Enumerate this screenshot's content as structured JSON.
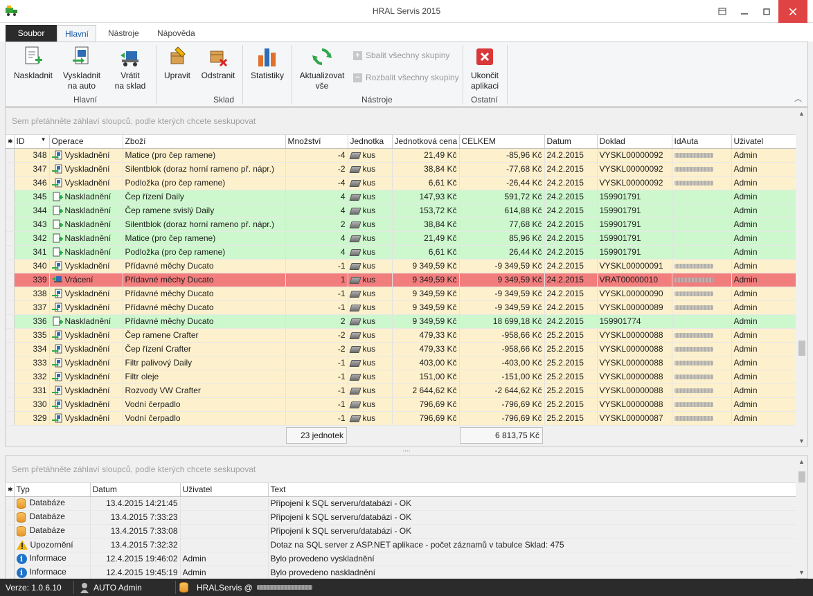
{
  "window": {
    "title": "HRAL Servis 2015"
  },
  "menu": {
    "file": "Soubor",
    "tabs": [
      "Hlavní",
      "Nástroje",
      "Nápověda"
    ]
  },
  "ribbon": {
    "buttons": {
      "naskladnit": "Naskladnit",
      "vyskladnit": "Vyskladnit\nna auto",
      "vratit": "Vrátit\nna sklad",
      "upravit": "Upravit",
      "odstranit": "Odstranit",
      "statistiky": "Statistiky",
      "aktualizovat": "Aktualizovat\nvše",
      "ukoncit": "Ukončit\naplikaci"
    },
    "small": {
      "collapse": "Sbalit všechny skupiny",
      "expand": "Rozbalit všechny skupiny"
    },
    "groups": {
      "hlavni": "Hlavní",
      "sklad": "Sklad",
      "nastroje": "Nástroje",
      "ostatni": "Ostatní"
    }
  },
  "grid": {
    "group_hint": "Sem přetáhněte záhlaví sloupců, podle kterých chcete seskupovat",
    "columns": [
      "ID",
      "Operace",
      "Zboží",
      "Množství",
      "Jednotka",
      "Jednotková cena",
      "CELKEM",
      "Datum",
      "Doklad",
      "IdAuta",
      "Uživatel"
    ],
    "rows": [
      {
        "id": "348",
        "op": "Vyskladnění",
        "type": "vy",
        "item": "Matice (pro čep ramene)",
        "qty": "-4",
        "unit": "kus",
        "price": "21,49 Kč",
        "total": "-85,96 Kč",
        "date": "24.2.2015",
        "doc": "VYSKL00000092",
        "car": true,
        "user": "Admin"
      },
      {
        "id": "347",
        "op": "Vyskladnění",
        "type": "vy",
        "item": "Silentblok (doraz horní rameno př. nápr.)",
        "qty": "-2",
        "unit": "kus",
        "price": "38,84 Kč",
        "total": "-77,68 Kč",
        "date": "24.2.2015",
        "doc": "VYSKL00000092",
        "car": true,
        "user": "Admin"
      },
      {
        "id": "346",
        "op": "Vyskladnění",
        "type": "vy",
        "item": "Podložka (pro čep ramene)",
        "qty": "-4",
        "unit": "kus",
        "price": "6,61 Kč",
        "total": "-26,44 Kč",
        "date": "24.2.2015",
        "doc": "VYSKL00000092",
        "car": true,
        "user": "Admin"
      },
      {
        "id": "345",
        "op": "Naskladnění",
        "type": "na",
        "item": "Čep řízení Daily",
        "qty": "4",
        "unit": "kus",
        "price": "147,93 Kč",
        "total": "591,72 Kč",
        "date": "24.2.2015",
        "doc": "159901791",
        "car": false,
        "user": "Admin"
      },
      {
        "id": "344",
        "op": "Naskladnění",
        "type": "na",
        "item": "Čep ramene svislý Daily",
        "qty": "4",
        "unit": "kus",
        "price": "153,72 Kč",
        "total": "614,88 Kč",
        "date": "24.2.2015",
        "doc": "159901791",
        "car": false,
        "user": "Admin"
      },
      {
        "id": "343",
        "op": "Naskladnění",
        "type": "na",
        "item": "Silentblok (doraz horní rameno př. nápr.)",
        "qty": "2",
        "unit": "kus",
        "price": "38,84 Kč",
        "total": "77,68 Kč",
        "date": "24.2.2015",
        "doc": "159901791",
        "car": false,
        "user": "Admin"
      },
      {
        "id": "342",
        "op": "Naskladnění",
        "type": "na",
        "item": "Matice (pro čep ramene)",
        "qty": "4",
        "unit": "kus",
        "price": "21,49 Kč",
        "total": "85,96 Kč",
        "date": "24.2.2015",
        "doc": "159901791",
        "car": false,
        "user": "Admin"
      },
      {
        "id": "341",
        "op": "Naskladnění",
        "type": "na",
        "item": "Podložka (pro čep ramene)",
        "qty": "4",
        "unit": "kus",
        "price": "6,61 Kč",
        "total": "26,44 Kč",
        "date": "24.2.2015",
        "doc": "159901791",
        "car": false,
        "user": "Admin"
      },
      {
        "id": "340",
        "op": "Vyskladnění",
        "type": "vy",
        "item": "Přídavné měchy Ducato",
        "qty": "-1",
        "unit": "kus",
        "price": "9 349,59 Kč",
        "total": "-9 349,59 Kč",
        "date": "24.2.2015",
        "doc": "VYSKL00000091",
        "car": true,
        "user": "Admin"
      },
      {
        "id": "339",
        "op": "Vrácení",
        "type": "vr",
        "item": "Přídavné měchy Ducato",
        "qty": "1",
        "unit": "kus",
        "price": "9 349,59 Kč",
        "total": "9 349,59 Kč",
        "date": "24.2.2015",
        "doc": "VRAT00000010",
        "car": true,
        "user": "Admin"
      },
      {
        "id": "338",
        "op": "Vyskladnění",
        "type": "vy",
        "item": "Přídavné měchy Ducato",
        "qty": "-1",
        "unit": "kus",
        "price": "9 349,59 Kč",
        "total": "-9 349,59 Kč",
        "date": "24.2.2015",
        "doc": "VYSKL00000090",
        "car": true,
        "user": "Admin"
      },
      {
        "id": "337",
        "op": "Vyskladnění",
        "type": "vy",
        "item": "Přídavné měchy Ducato",
        "qty": "-1",
        "unit": "kus",
        "price": "9 349,59 Kč",
        "total": "-9 349,59 Kč",
        "date": "24.2.2015",
        "doc": "VYSKL00000089",
        "car": true,
        "user": "Admin"
      },
      {
        "id": "336",
        "op": "Naskladnění",
        "type": "na",
        "item": "Přídavné měchy Ducato",
        "qty": "2",
        "unit": "kus",
        "price": "9 349,59 Kč",
        "total": "18 699,18 Kč",
        "date": "24.2.2015",
        "doc": "159901774",
        "car": false,
        "user": "Admin"
      },
      {
        "id": "335",
        "op": "Vyskladnění",
        "type": "vy",
        "item": "Čep ramene Crafter",
        "qty": "-2",
        "unit": "kus",
        "price": "479,33 Kč",
        "total": "-958,66 Kč",
        "date": "25.2.2015",
        "doc": "VYSKL00000088",
        "car": true,
        "user": "Admin"
      },
      {
        "id": "334",
        "op": "Vyskladnění",
        "type": "vy",
        "item": "Čep řízení Crafter",
        "qty": "-2",
        "unit": "kus",
        "price": "479,33 Kč",
        "total": "-958,66 Kč",
        "date": "25.2.2015",
        "doc": "VYSKL00000088",
        "car": true,
        "user": "Admin"
      },
      {
        "id": "333",
        "op": "Vyskladnění",
        "type": "vy",
        "item": "Filtr palivový Daily",
        "qty": "-1",
        "unit": "kus",
        "price": "403,00 Kč",
        "total": "-403,00 Kč",
        "date": "25.2.2015",
        "doc": "VYSKL00000088",
        "car": true,
        "user": "Admin"
      },
      {
        "id": "332",
        "op": "Vyskladnění",
        "type": "vy",
        "item": "Filtr oleje",
        "qty": "-1",
        "unit": "kus",
        "price": "151,00 Kč",
        "total": "-151,00 Kč",
        "date": "25.2.2015",
        "doc": "VYSKL00000088",
        "car": true,
        "user": "Admin"
      },
      {
        "id": "331",
        "op": "Vyskladnění",
        "type": "vy",
        "item": "Rozvody VW Crafter",
        "qty": "-1",
        "unit": "kus",
        "price": "2 644,62 Kč",
        "total": "-2 644,62 Kč",
        "date": "25.2.2015",
        "doc": "VYSKL00000088",
        "car": true,
        "user": "Admin"
      },
      {
        "id": "330",
        "op": "Vyskladnění",
        "type": "vy",
        "item": "Vodní čerpadlo",
        "qty": "-1",
        "unit": "kus",
        "price": "796,69 Kč",
        "total": "-796,69 Kč",
        "date": "25.2.2015",
        "doc": "VYSKL00000088",
        "car": true,
        "user": "Admin"
      },
      {
        "id": "329",
        "op": "Vyskladnění",
        "type": "vy",
        "item": "Vodní čerpadlo",
        "qty": "-1",
        "unit": "kus",
        "price": "796,69 Kč",
        "total": "-796,69 Kč",
        "date": "25.2.2015",
        "doc": "VYSKL00000087",
        "car": true,
        "user": "Admin"
      }
    ],
    "summary": {
      "qty": "23 jednotek",
      "total": "6 813,75 Kč"
    }
  },
  "log": {
    "group_hint": "Sem přetáhněte záhlaví sloupců, podle kterých chcete seskupovat",
    "columns": [
      "Typ",
      "Datum",
      "Uživatel",
      "Text"
    ],
    "rows": [
      {
        "type": "Databáze",
        "icon": "db",
        "date": "13.4.2015 14:21:45",
        "user": "",
        "text": "Připojení k SQL serveru/databázi - OK"
      },
      {
        "type": "Databáze",
        "icon": "db",
        "date": "13.4.2015 7:33:23",
        "user": "",
        "text": "Připojení k SQL serveru/databázi - OK"
      },
      {
        "type": "Databáze",
        "icon": "db",
        "date": "13.4.2015 7:33:08",
        "user": "",
        "text": "Připojení k SQL serveru/databázi - OK"
      },
      {
        "type": "Upozornění",
        "icon": "warn",
        "date": "13.4.2015 7:32:32",
        "user": "",
        "text": "Dotaz na SQL server z ASP.NET aplikace - počet záznamů v tabulce Sklad: 475"
      },
      {
        "type": "Informace",
        "icon": "info",
        "date": "12.4.2015 19:46:02",
        "user": "Admin",
        "text": "Bylo provedeno vyskladnění"
      },
      {
        "type": "Informace",
        "icon": "info",
        "date": "12.4.2015 19:45:19",
        "user": "Admin",
        "text": "Bylo provedeno naskladnění"
      }
    ]
  },
  "status": {
    "version": "Verze: 1.0.6.10",
    "user": "AUTO Admin",
    "db": "HRALServis @"
  },
  "colors": {
    "row_out": "#fdf0cc",
    "row_in": "#cdf7cd",
    "row_return": "#f27d7d",
    "accent": "#1d5aa8",
    "statusbar": "#2b2b2b"
  }
}
